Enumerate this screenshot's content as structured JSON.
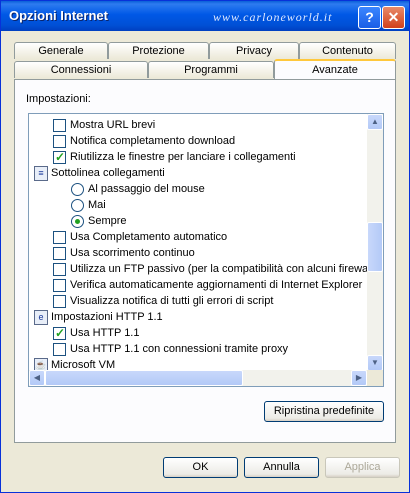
{
  "window": {
    "title": "Opzioni Internet",
    "watermark": "www.carloneworld.it",
    "help_label": "?",
    "close_label": "✕"
  },
  "tabs_back": [
    "Generale",
    "Protezione",
    "Privacy",
    "Contenuto"
  ],
  "tabs_front": [
    "Connessioni",
    "Programmi",
    "Avanzate"
  ],
  "active_tab": "Avanzate",
  "settings_label": "Impostazioni:",
  "items": [
    {
      "type": "checkbox",
      "checked": false,
      "label": "Mostra URL brevi"
    },
    {
      "type": "checkbox",
      "checked": false,
      "label": "Notifica completamento download"
    },
    {
      "type": "checkbox",
      "checked": true,
      "label": "Riutilizza le finestre per lanciare i collegamenti"
    },
    {
      "type": "group",
      "icon": "link-settings-icon",
      "label": "Sottolinea collegamenti"
    },
    {
      "type": "radio",
      "checked": false,
      "label": "Al passaggio del mouse"
    },
    {
      "type": "radio",
      "checked": false,
      "label": "Mai"
    },
    {
      "type": "radio",
      "checked": true,
      "label": "Sempre"
    },
    {
      "type": "checkbox",
      "checked": false,
      "label": "Usa Completamento automatico"
    },
    {
      "type": "checkbox",
      "checked": false,
      "label": "Usa scorrimento continuo"
    },
    {
      "type": "checkbox",
      "checked": false,
      "label": "Utilizza un FTP passivo (per la compatibilità con alcuni firewall"
    },
    {
      "type": "checkbox",
      "checked": false,
      "label": "Verifica automaticamente aggiornamenti di Internet Explorer"
    },
    {
      "type": "checkbox",
      "checked": false,
      "label": "Visualizza notifica di tutti gli errori di script"
    },
    {
      "type": "group",
      "icon": "ie-icon",
      "label": "Impostazioni HTTP 1.1"
    },
    {
      "type": "checkbox",
      "checked": true,
      "label": "Usa HTTP 1.1"
    },
    {
      "type": "checkbox",
      "checked": false,
      "label": "Usa HTTP 1.1 con connessioni tramite proxy"
    },
    {
      "type": "group",
      "icon": "java-vm-icon",
      "label": "Microsoft VM"
    }
  ],
  "restore_button": "Ripristina predefinite",
  "buttons": {
    "ok": "OK",
    "cancel": "Annulla",
    "apply": "Applica"
  }
}
